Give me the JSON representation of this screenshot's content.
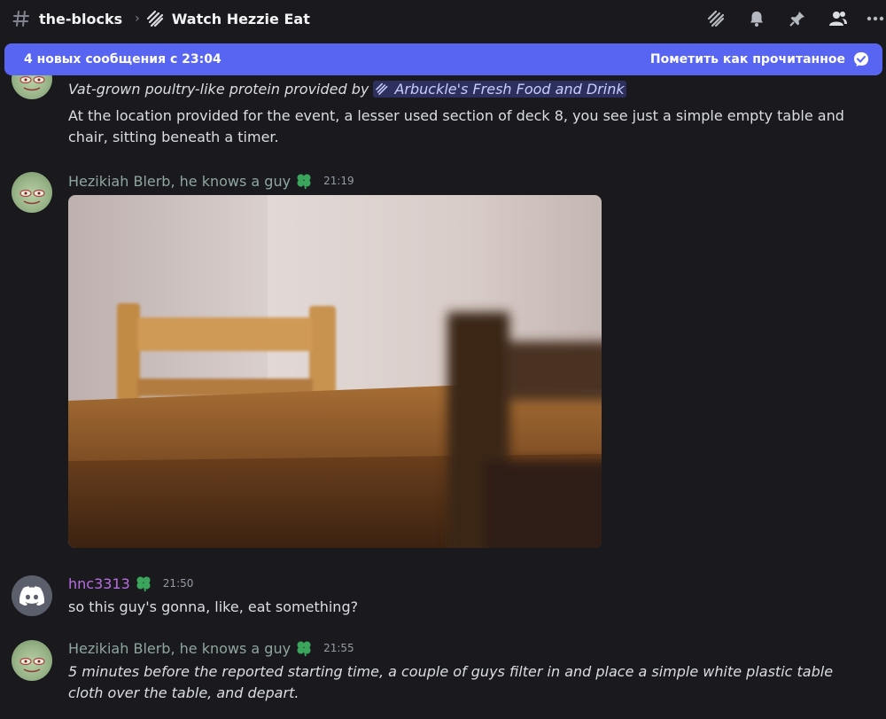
{
  "header": {
    "channel": "the-blocks",
    "thread": "Watch Hezzie Eat"
  },
  "banner": {
    "text": "4 новых сообщения с 23:04",
    "mark_read": "Пометить как прочитанное",
    "color": "#5865f2"
  },
  "messages": [
    {
      "line1_prefix": "Vat-grown poultry-like protein provided by",
      "mention": "Arbuckle's Fresh Food and Drink",
      "body": "At the location provided for the event, a lesser used section of deck 8, you see just a simple empty table and chair, sitting beneath a timer."
    },
    {
      "username": "Hezikiah Blerb, he knows a guy",
      "username_color": "#8fa6a0",
      "time": "21:19"
    },
    {
      "username": "hnc3313",
      "username_color": "#b86ee3",
      "time": "21:50",
      "body": "so this guy's gonna, like, eat something?"
    },
    {
      "username": "Hezikiah Blerb, he knows a guy",
      "username_color": "#8fa6a0",
      "time": "21:55",
      "body": "5 minutes before the reported starting time, a couple of guys filter in and place a simple white plastic table cloth over the table, and depart."
    }
  ],
  "icons": {
    "channel": "hash-icon",
    "thread": "thread-icon",
    "badge": "clover-icon"
  }
}
